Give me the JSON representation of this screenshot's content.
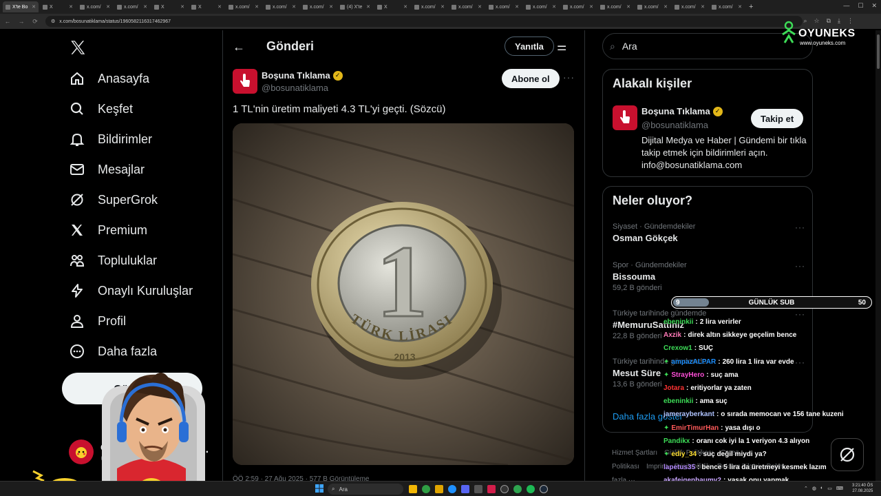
{
  "browser": {
    "tabs": [
      "X'te Bo",
      "X",
      "x.com/",
      "x.com/",
      "X",
      "X",
      "x.com/",
      "x.com/",
      "x.com/",
      "(4) X'te",
      "X",
      "x.com/",
      "x.com/",
      "x.com/",
      "x.com/",
      "x.com/",
      "x.com/",
      "x.com/",
      "x.com/",
      "x.com/"
    ],
    "url": "x.com/bosunatiklama/status/1960582116317462967"
  },
  "nav": {
    "items": [
      {
        "label": "Anasayfa",
        "icon": "home-icon"
      },
      {
        "label": "Keşfet",
        "icon": "search-icon"
      },
      {
        "label": "Bildirimler",
        "icon": "bell-icon"
      },
      {
        "label": "Mesajlar",
        "icon": "mail-icon"
      },
      {
        "label": "SuperGrok",
        "icon": "grok-icon"
      },
      {
        "label": "Premium",
        "icon": "x-icon"
      },
      {
        "label": "Topluluklar",
        "icon": "communities-icon"
      },
      {
        "label": "Onaylı Kuruluşlar",
        "icon": "lightning-icon"
      },
      {
        "label": "Profil",
        "icon": "user-icon"
      },
      {
        "label": "Daha fazla",
        "icon": "more-circle-icon"
      }
    ],
    "post_label": "Gönder",
    "profile_name": "C",
    "profile_handle": "@c"
  },
  "header": {
    "title": "Gönderi",
    "reply_label": "Yanıtla"
  },
  "tweet": {
    "author_name": "Boşuna Tıklama",
    "author_handle": "@bosunatiklama",
    "subscribe_label": "Abone ol",
    "text": "1 TL'nin üretim maliyeti 4.3 TL'yi geçti. (Sözcü)",
    "coin_text": "TÜRK LİRASI",
    "coin_year": "2013",
    "coin_value": "1",
    "meta": "ÖÖ 2:59 · 27 Ağu 2025 · 577 B Görüntüleme"
  },
  "right": {
    "search_placeholder": "Ara",
    "related_title": "Alakalı kişiler",
    "related": {
      "name": "Boşuna Tıklama",
      "handle": "@bosunatiklama",
      "follow_label": "Takip et",
      "bio": "Dijital Medya ve Haber | Gündemi bir tıkla takip etmek için bildirimleri açın. info@bosunatiklama.com"
    },
    "trends_title": "Neler oluyor?",
    "trends": [
      {
        "category": "Siyaset · Gündemdekiler",
        "name": "Osman Gökçek",
        "count": ""
      },
      {
        "category": "Spor · Gündemdekiler",
        "name": "Bissouma",
        "count": "59,2 B gönderi"
      },
      {
        "category": "Türkiye tarihinde gündemde",
        "name": "#MemuruSattınız",
        "count": "22,8 B gönderi"
      },
      {
        "category": "Türkiye tarihinde gündemde",
        "name": "Mesut Süre",
        "count": "13,6 B gönderi"
      }
    ],
    "show_more": "Daha fazla göster",
    "footer": [
      "Hizmet Şartları",
      "Gizlilik Politikası",
      "Çerez Politikası",
      "Imprint",
      "Erişilebilirlik",
      "Reklam bilgisi",
      "Daha fazla ···"
    ]
  },
  "overlay": {
    "brand": "OYUNEKS",
    "brand_url": "www.oyuneks.com",
    "sub_current": "9",
    "sub_label": "GÜNLÜK SUB",
    "sub_goal": "50",
    "sub_progress": 0.18,
    "chat": [
      {
        "user": "ebeninkii",
        "msg": "2 lira verirler",
        "color": "#3ddc57",
        "badge": false
      },
      {
        "user": "Axzik",
        "msg": "direk altın sikkeye geçelim bence",
        "color": "#ff7ab8",
        "badge": false
      },
      {
        "user": "Crexow1",
        "msg": "SUÇ",
        "color": "#3ddc57",
        "badge": false
      },
      {
        "user": "ampazALPAR",
        "msg": "260 lira 1 lira var evde",
        "color": "#1e90ff",
        "badge": true
      },
      {
        "user": "StrayHero",
        "msg": "suç ama",
        "color": "#ff4fd8",
        "badge": true
      },
      {
        "user": "Jotara",
        "msg": "eritiyorlar ya zaten",
        "color": "#ff3333",
        "badge": false
      },
      {
        "user": "ebeninkii",
        "msg": "ama suç",
        "color": "#3ddc57",
        "badge": false
      },
      {
        "user": "jamerayberkant",
        "msg": "o sırada memocan ve 156 tane kuzeni",
        "color": "#b0c4ff",
        "badge": false
      },
      {
        "user": "EmirTimurHan",
        "msg": "yasa dışı o",
        "color": "#ff5a5a",
        "badge": true
      },
      {
        "user": "Pandikx",
        "msg": "oranı cok iyi la 1 veriyon 4.3 alıyon",
        "color": "#3ddc57",
        "badge": false
      },
      {
        "user": "ediy_34",
        "msg": "suç değil miydi ya?",
        "color": "#ffe135",
        "badge": true
      },
      {
        "user": "lapetus35",
        "msg": "bence 5 lira da üretmeyi kesmek lazım",
        "color": "#b58cff",
        "badge": false
      },
      {
        "user": "akafeigenbaumv2",
        "msg": "yasak onu yapmak",
        "color": "#c9a6ff",
        "badge": false
      }
    ]
  },
  "taskbar": {
    "search": "Ara",
    "time": "3:21:40 ÖS",
    "date": "27.08.2025"
  }
}
